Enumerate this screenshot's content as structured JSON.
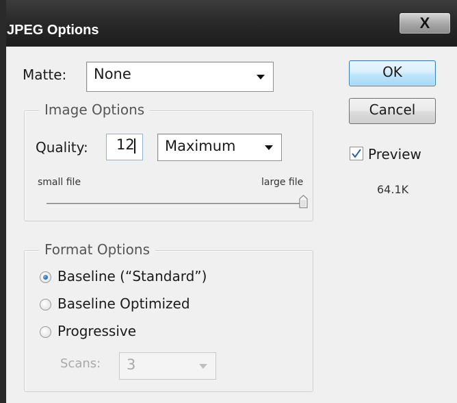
{
  "window": {
    "title": "JPEG Options",
    "close_label": "X"
  },
  "matte": {
    "label": "Matte:",
    "value": "None"
  },
  "image_options": {
    "legend": "Image Options",
    "quality_label": "Quality:",
    "quality_value": "12",
    "quality_preset": "Maximum",
    "small_file_label": "small file",
    "large_file_label": "large file",
    "slider_level": 1.0
  },
  "format_options": {
    "legend": "Format Options",
    "radios": [
      {
        "label": "Baseline (“Standard”)",
        "checked": true
      },
      {
        "label": "Baseline Optimized",
        "checked": false
      },
      {
        "label": "Progressive",
        "checked": false
      }
    ],
    "scans_label": "Scans:",
    "scans_value": "3"
  },
  "buttons": {
    "ok": "OK",
    "cancel": "Cancel"
  },
  "preview": {
    "label": "Preview",
    "checked": true,
    "size": "64.1K"
  },
  "colors": {
    "title_bar": "#2a2a2a",
    "accent": "#2a6fb8",
    "background": "#f0f0f0"
  }
}
